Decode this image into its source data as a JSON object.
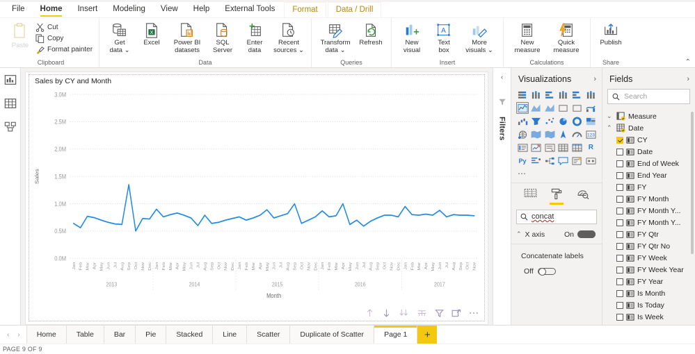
{
  "ribbon": {
    "tabs": [
      {
        "label": "File",
        "state": "normal"
      },
      {
        "label": "Home",
        "state": "active"
      },
      {
        "label": "Insert",
        "state": "normal"
      },
      {
        "label": "Modeling",
        "state": "normal"
      },
      {
        "label": "View",
        "state": "normal"
      },
      {
        "label": "Help",
        "state": "normal"
      },
      {
        "label": "External Tools",
        "state": "normal"
      },
      {
        "label": "Format",
        "state": "contextual"
      },
      {
        "label": "Data / Drill",
        "state": "contextual"
      }
    ],
    "groups": [
      {
        "name": "Clipboard",
        "label": "Clipboard",
        "paste": "Paste",
        "items": [
          {
            "label": "Cut",
            "icon": "scissors-icon"
          },
          {
            "label": "Copy",
            "icon": "copy-icon"
          },
          {
            "label": "Format painter",
            "icon": "format-painter-icon"
          }
        ]
      },
      {
        "name": "Data",
        "label": "Data",
        "items": [
          {
            "label": "Get\ndata",
            "line1": "Get",
            "line2": "data",
            "caret": true,
            "icon": "get-data-icon"
          },
          {
            "label": "Excel",
            "line1": "Excel",
            "line2": "",
            "caret": false,
            "icon": "excel-icon"
          },
          {
            "label": "Power BI datasets",
            "line1": "Power BI",
            "line2": "datasets",
            "caret": false,
            "icon": "powerbi-datasets-icon"
          },
          {
            "label": "SQL Server",
            "line1": "SQL",
            "line2": "Server",
            "caret": false,
            "icon": "sql-server-icon"
          },
          {
            "label": "Enter data",
            "line1": "Enter",
            "line2": "data",
            "caret": false,
            "icon": "enter-data-icon"
          },
          {
            "label": "Recent sources",
            "line1": "Recent",
            "line2": "sources",
            "caret": true,
            "icon": "recent-sources-icon"
          }
        ]
      },
      {
        "name": "Queries",
        "label": "Queries",
        "items": [
          {
            "label": "Transform data",
            "line1": "Transform",
            "line2": "data",
            "caret": true,
            "icon": "transform-data-icon"
          },
          {
            "label": "Refresh",
            "line1": "Refresh",
            "line2": "",
            "caret": false,
            "icon": "refresh-icon"
          }
        ]
      },
      {
        "name": "Insert",
        "label": "Insert",
        "items": [
          {
            "label": "New visual",
            "line1": "New",
            "line2": "visual",
            "caret": false,
            "icon": "new-visual-icon"
          },
          {
            "label": "Text box",
            "line1": "Text",
            "line2": "box",
            "caret": false,
            "icon": "text-box-icon"
          },
          {
            "label": "More visuals",
            "line1": "More",
            "line2": "visuals",
            "caret": true,
            "icon": "more-visuals-icon"
          }
        ]
      },
      {
        "name": "Calculations",
        "label": "Calculations",
        "items": [
          {
            "label": "New measure",
            "line1": "New",
            "line2": "measure",
            "caret": false,
            "icon": "new-measure-icon"
          },
          {
            "label": "Quick measure",
            "line1": "Quick",
            "line2": "measure",
            "caret": false,
            "icon": "quick-measure-icon"
          }
        ]
      },
      {
        "name": "Share",
        "label": "Share",
        "items": [
          {
            "label": "Publish",
            "line1": "Publish",
            "line2": "",
            "caret": false,
            "icon": "publish-icon"
          }
        ]
      }
    ]
  },
  "view_rail": [
    {
      "name": "report-view",
      "label": "Report view",
      "active": true
    },
    {
      "name": "data-view",
      "label": "Data view",
      "active": false
    },
    {
      "name": "model-view",
      "label": "Model view",
      "active": false
    }
  ],
  "filters_pane": {
    "label": "Filters"
  },
  "visual": {
    "title": "Sales by CY and Month",
    "footer_icons": [
      {
        "name": "drill-up-icon",
        "label": "Drill up"
      },
      {
        "name": "drill-down-icon",
        "label": "Drill down"
      },
      {
        "name": "expand-all-icon",
        "label": "Expand all down one level"
      },
      {
        "name": "drill-mode-icon",
        "label": "Go to next level"
      },
      {
        "name": "filter-icon",
        "label": "Filters"
      },
      {
        "name": "focus-mode-icon",
        "label": "Focus mode"
      },
      {
        "name": "more-options-icon",
        "label": "More options"
      }
    ]
  },
  "chart_data": {
    "type": "line",
    "title": "Sales by CY and Month",
    "xlabel": "Month",
    "ylabel": "Sales",
    "ylim": [
      0,
      3000000
    ],
    "ytick_labels": [
      "0.0M",
      "0.5M",
      "1.0M",
      "1.5M",
      "2.0M",
      "2.5M",
      "3.0M"
    ],
    "ytick_values": [
      0,
      500000,
      1000000,
      1500000,
      2000000,
      2500000,
      3000000
    ],
    "grid": true,
    "legend": "none",
    "line_color": "#1f8ae8",
    "months": [
      "Jan",
      "Feb",
      "Mar",
      "Apr",
      "May",
      "Jun",
      "Jul",
      "Aug",
      "Sep",
      "Oct",
      "Nov",
      "Dec"
    ],
    "year_groups": [
      {
        "year": "2013",
        "months": 12
      },
      {
        "year": "2014",
        "months": 12
      },
      {
        "year": "2015",
        "months": 12
      },
      {
        "year": "2016",
        "months": 12
      },
      {
        "year": "2017",
        "months": 11
      }
    ],
    "series": [
      {
        "name": "Sales",
        "values": [
          640000,
          560000,
          770000,
          745000,
          700000,
          660000,
          630000,
          620000,
          1350000,
          500000,
          730000,
          720000,
          900000,
          760000,
          800000,
          830000,
          790000,
          740000,
          600000,
          790000,
          640000,
          660000,
          700000,
          730000,
          760000,
          700000,
          740000,
          790000,
          890000,
          740000,
          780000,
          820000,
          1000000,
          640000,
          700000,
          760000,
          870000,
          760000,
          780000,
          1000000,
          620000,
          700000,
          590000,
          680000,
          740000,
          790000,
          790000,
          760000,
          950000,
          800000,
          790000,
          810000,
          790000,
          880000,
          760000,
          800000,
          790000,
          790000,
          780000
        ]
      }
    ]
  },
  "visualizations_pane": {
    "title": "Visualizations",
    "gallery": [
      {
        "name": "stacked-bar-chart-icon",
        "selected": false
      },
      {
        "name": "stacked-column-chart-icon",
        "selected": false
      },
      {
        "name": "clustered-bar-chart-icon",
        "selected": false
      },
      {
        "name": "clustered-column-chart-icon",
        "selected": false
      },
      {
        "name": "100-stacked-bar-chart-icon",
        "selected": false
      },
      {
        "name": "100-stacked-column-chart-icon",
        "selected": false
      },
      {
        "name": "line-chart-icon",
        "selected": true
      },
      {
        "name": "area-chart-icon",
        "selected": false
      },
      {
        "name": "stacked-area-chart-icon",
        "selected": false
      },
      {
        "name": "line-stacked-column-chart-icon",
        "selected": false
      },
      {
        "name": "line-clustered-column-chart-icon",
        "selected": false
      },
      {
        "name": "ribbon-chart-icon",
        "selected": false
      },
      {
        "name": "waterfall-chart-icon",
        "selected": false
      },
      {
        "name": "funnel-chart-icon",
        "selected": false
      },
      {
        "name": "scatter-chart-icon",
        "selected": false
      },
      {
        "name": "pie-chart-icon",
        "selected": false
      },
      {
        "name": "donut-chart-icon",
        "selected": false
      },
      {
        "name": "treemap-icon",
        "selected": false
      },
      {
        "name": "map-icon",
        "selected": false
      },
      {
        "name": "filled-map-icon",
        "selected": false
      },
      {
        "name": "shape-map-icon",
        "selected": false
      },
      {
        "name": "arcgis-map-icon",
        "selected": false
      },
      {
        "name": "gauge-icon",
        "selected": false
      },
      {
        "name": "card-icon",
        "selected": false
      },
      {
        "name": "multi-row-card-icon",
        "selected": false
      },
      {
        "name": "kpi-icon",
        "selected": false
      },
      {
        "name": "slicer-icon",
        "selected": false
      },
      {
        "name": "table-icon",
        "selected": false
      },
      {
        "name": "matrix-icon",
        "selected": false
      },
      {
        "name": "r-script-visual-icon",
        "selected": false
      },
      {
        "name": "python-visual-icon",
        "selected": false
      },
      {
        "name": "key-influencers-icon",
        "selected": false
      },
      {
        "name": "decomposition-tree-icon",
        "selected": false
      },
      {
        "name": "qa-visual-icon",
        "selected": false
      },
      {
        "name": "smart-narrative-icon",
        "selected": false
      },
      {
        "name": "paginated-report-icon",
        "selected": false
      }
    ],
    "more_glyph": "⋯",
    "format_tabs": [
      {
        "name": "fields-tab",
        "label": "Fields",
        "active": false
      },
      {
        "name": "format-tab",
        "label": "Format",
        "active": true
      },
      {
        "name": "analytics-tab",
        "label": "Analytics",
        "active": false
      }
    ],
    "search_value": "concat",
    "search_placeholder": "Search",
    "x_axis_section": "X axis",
    "x_axis_toggle_label": "On",
    "x_axis_toggle_state": "on",
    "concat_label": "Concatenate labels",
    "concat_toggle_label": "Off",
    "concat_toggle_state": "off"
  },
  "fields_pane": {
    "title": "Fields",
    "search_placeholder": "Search",
    "tables": [
      {
        "name": "Measure",
        "expanded": false,
        "icon": "measure-table-icon",
        "fields": []
      },
      {
        "name": "Date",
        "expanded": true,
        "icon": "date-table-icon",
        "fields": [
          {
            "label": "CY",
            "checked": true
          },
          {
            "label": "Date",
            "checked": false
          },
          {
            "label": "End of Week",
            "checked": false
          },
          {
            "label": "End Year",
            "checked": false
          },
          {
            "label": "FY",
            "checked": false
          },
          {
            "label": "FY Month",
            "checked": false
          },
          {
            "label": "FY Month Y...",
            "checked": false
          },
          {
            "label": "FY Month Y...",
            "checked": false
          },
          {
            "label": "FY Qtr",
            "checked": false
          },
          {
            "label": "FY Qtr No",
            "checked": false
          },
          {
            "label": "FY Week",
            "checked": false
          },
          {
            "label": "FY Week Year",
            "checked": false
          },
          {
            "label": "FY Year",
            "checked": false
          },
          {
            "label": "Is Month",
            "checked": false
          },
          {
            "label": "Is Today",
            "checked": false
          },
          {
            "label": "Is Week",
            "checked": false
          }
        ]
      }
    ]
  },
  "page_tabs": {
    "tabs": [
      {
        "label": "Home",
        "active": false
      },
      {
        "label": "Table",
        "active": false
      },
      {
        "label": "Bar",
        "active": false
      },
      {
        "label": "Pie",
        "active": false
      },
      {
        "label": "Stacked",
        "active": false
      },
      {
        "label": "Line",
        "active": false
      },
      {
        "label": "Scatter",
        "active": false
      },
      {
        "label": "Duplicate of Scatter",
        "active": false
      },
      {
        "label": "Page 1",
        "active": true
      }
    ],
    "add_label": "+"
  },
  "status_bar": {
    "text": "PAGE 9 OF 9"
  },
  "colors": {
    "accent": "#f2c811",
    "line": "#1f8ae8",
    "contextual_tab_text": "#b5890b"
  }
}
